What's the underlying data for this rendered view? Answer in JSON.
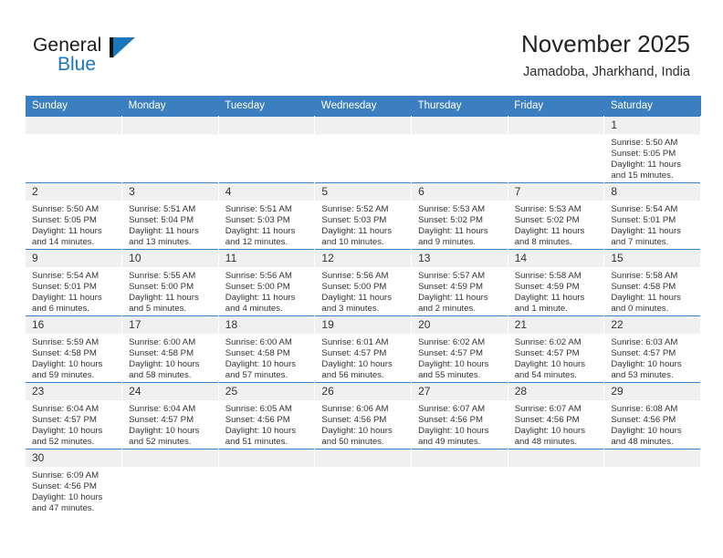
{
  "brand": {
    "word_one": "General",
    "word_two": "Blue",
    "accent_color": "#1b76bc",
    "bar_color": "#111111",
    "logo_icon": "triangle-flag-icon"
  },
  "header": {
    "title": "November 2025",
    "location": "Jamadoba, Jharkhand, India"
  },
  "calendar": {
    "header_color": "#3c7fc0",
    "daynum_bg": "#f0f0f0",
    "weekday_headers": [
      "Sunday",
      "Monday",
      "Tuesday",
      "Wednesday",
      "Thursday",
      "Friday",
      "Saturday"
    ],
    "labels": {
      "sunrise": "Sunrise:",
      "sunset": "Sunset:",
      "daylight": "Daylight:"
    },
    "weeks": [
      [
        {
          "day": "",
          "empty": true
        },
        {
          "day": "",
          "empty": true
        },
        {
          "day": "",
          "empty": true
        },
        {
          "day": "",
          "empty": true
        },
        {
          "day": "",
          "empty": true
        },
        {
          "day": "",
          "empty": true
        },
        {
          "day": "1",
          "sunrise": "Sunrise: 5:50 AM",
          "sunset": "Sunset: 5:05 PM",
          "daylight": "Daylight: 11 hours and 15 minutes."
        }
      ],
      [
        {
          "day": "2",
          "sunrise": "Sunrise: 5:50 AM",
          "sunset": "Sunset: 5:05 PM",
          "daylight": "Daylight: 11 hours and 14 minutes."
        },
        {
          "day": "3",
          "sunrise": "Sunrise: 5:51 AM",
          "sunset": "Sunset: 5:04 PM",
          "daylight": "Daylight: 11 hours and 13 minutes."
        },
        {
          "day": "4",
          "sunrise": "Sunrise: 5:51 AM",
          "sunset": "Sunset: 5:03 PM",
          "daylight": "Daylight: 11 hours and 12 minutes."
        },
        {
          "day": "5",
          "sunrise": "Sunrise: 5:52 AM",
          "sunset": "Sunset: 5:03 PM",
          "daylight": "Daylight: 11 hours and 10 minutes."
        },
        {
          "day": "6",
          "sunrise": "Sunrise: 5:53 AM",
          "sunset": "Sunset: 5:02 PM",
          "daylight": "Daylight: 11 hours and 9 minutes."
        },
        {
          "day": "7",
          "sunrise": "Sunrise: 5:53 AM",
          "sunset": "Sunset: 5:02 PM",
          "daylight": "Daylight: 11 hours and 8 minutes."
        },
        {
          "day": "8",
          "sunrise": "Sunrise: 5:54 AM",
          "sunset": "Sunset: 5:01 PM",
          "daylight": "Daylight: 11 hours and 7 minutes."
        }
      ],
      [
        {
          "day": "9",
          "sunrise": "Sunrise: 5:54 AM",
          "sunset": "Sunset: 5:01 PM",
          "daylight": "Daylight: 11 hours and 6 minutes."
        },
        {
          "day": "10",
          "sunrise": "Sunrise: 5:55 AM",
          "sunset": "Sunset: 5:00 PM",
          "daylight": "Daylight: 11 hours and 5 minutes."
        },
        {
          "day": "11",
          "sunrise": "Sunrise: 5:56 AM",
          "sunset": "Sunset: 5:00 PM",
          "daylight": "Daylight: 11 hours and 4 minutes."
        },
        {
          "day": "12",
          "sunrise": "Sunrise: 5:56 AM",
          "sunset": "Sunset: 5:00 PM",
          "daylight": "Daylight: 11 hours and 3 minutes."
        },
        {
          "day": "13",
          "sunrise": "Sunrise: 5:57 AM",
          "sunset": "Sunset: 4:59 PM",
          "daylight": "Daylight: 11 hours and 2 minutes."
        },
        {
          "day": "14",
          "sunrise": "Sunrise: 5:58 AM",
          "sunset": "Sunset: 4:59 PM",
          "daylight": "Daylight: 11 hours and 1 minute."
        },
        {
          "day": "15",
          "sunrise": "Sunrise: 5:58 AM",
          "sunset": "Sunset: 4:58 PM",
          "daylight": "Daylight: 11 hours and 0 minutes."
        }
      ],
      [
        {
          "day": "16",
          "sunrise": "Sunrise: 5:59 AM",
          "sunset": "Sunset: 4:58 PM",
          "daylight": "Daylight: 10 hours and 59 minutes."
        },
        {
          "day": "17",
          "sunrise": "Sunrise: 6:00 AM",
          "sunset": "Sunset: 4:58 PM",
          "daylight": "Daylight: 10 hours and 58 minutes."
        },
        {
          "day": "18",
          "sunrise": "Sunrise: 6:00 AM",
          "sunset": "Sunset: 4:58 PM",
          "daylight": "Daylight: 10 hours and 57 minutes."
        },
        {
          "day": "19",
          "sunrise": "Sunrise: 6:01 AM",
          "sunset": "Sunset: 4:57 PM",
          "daylight": "Daylight: 10 hours and 56 minutes."
        },
        {
          "day": "20",
          "sunrise": "Sunrise: 6:02 AM",
          "sunset": "Sunset: 4:57 PM",
          "daylight": "Daylight: 10 hours and 55 minutes."
        },
        {
          "day": "21",
          "sunrise": "Sunrise: 6:02 AM",
          "sunset": "Sunset: 4:57 PM",
          "daylight": "Daylight: 10 hours and 54 minutes."
        },
        {
          "day": "22",
          "sunrise": "Sunrise: 6:03 AM",
          "sunset": "Sunset: 4:57 PM",
          "daylight": "Daylight: 10 hours and 53 minutes."
        }
      ],
      [
        {
          "day": "23",
          "sunrise": "Sunrise: 6:04 AM",
          "sunset": "Sunset: 4:57 PM",
          "daylight": "Daylight: 10 hours and 52 minutes."
        },
        {
          "day": "24",
          "sunrise": "Sunrise: 6:04 AM",
          "sunset": "Sunset: 4:57 PM",
          "daylight": "Daylight: 10 hours and 52 minutes."
        },
        {
          "day": "25",
          "sunrise": "Sunrise: 6:05 AM",
          "sunset": "Sunset: 4:56 PM",
          "daylight": "Daylight: 10 hours and 51 minutes."
        },
        {
          "day": "26",
          "sunrise": "Sunrise: 6:06 AM",
          "sunset": "Sunset: 4:56 PM",
          "daylight": "Daylight: 10 hours and 50 minutes."
        },
        {
          "day": "27",
          "sunrise": "Sunrise: 6:07 AM",
          "sunset": "Sunset: 4:56 PM",
          "daylight": "Daylight: 10 hours and 49 minutes."
        },
        {
          "day": "28",
          "sunrise": "Sunrise: 6:07 AM",
          "sunset": "Sunset: 4:56 PM",
          "daylight": "Daylight: 10 hours and 48 minutes."
        },
        {
          "day": "29",
          "sunrise": "Sunrise: 6:08 AM",
          "sunset": "Sunset: 4:56 PM",
          "daylight": "Daylight: 10 hours and 48 minutes."
        }
      ],
      [
        {
          "day": "30",
          "sunrise": "Sunrise: 6:09 AM",
          "sunset": "Sunset: 4:56 PM",
          "daylight": "Daylight: 10 hours and 47 minutes."
        },
        {
          "day": "",
          "empty": true
        },
        {
          "day": "",
          "empty": true
        },
        {
          "day": "",
          "empty": true
        },
        {
          "day": "",
          "empty": true
        },
        {
          "day": "",
          "empty": true
        },
        {
          "day": "",
          "empty": true
        }
      ]
    ]
  }
}
